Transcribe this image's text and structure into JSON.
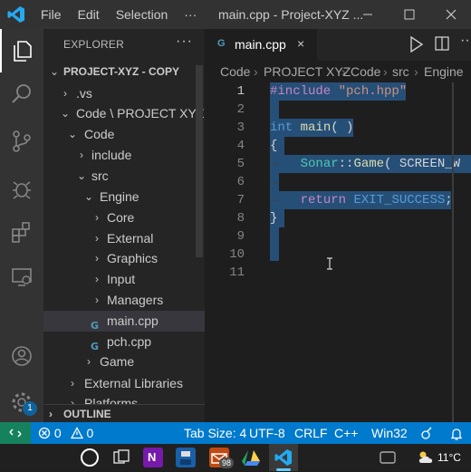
{
  "titlebar": {
    "menus": [
      "File",
      "Edit",
      "Selection",
      "···"
    ],
    "title": "main.cpp - Project-XYZ ..."
  },
  "explorer": {
    "header": "EXPLORER",
    "more": "···",
    "root": "PROJECT-XYZ - COPY",
    "items": [
      {
        "label": ".vs",
        "expanded": false
      },
      {
        "label": "Code \\ PROJECT XYZ",
        "expanded": true
      },
      {
        "label": "Code",
        "expanded": true
      },
      {
        "label": "include",
        "expanded": false
      },
      {
        "label": "src",
        "expanded": true
      },
      {
        "label": "Engine",
        "expanded": true
      },
      {
        "label": "Core",
        "expanded": false
      },
      {
        "label": "External",
        "expanded": false
      },
      {
        "label": "Graphics",
        "expanded": false
      },
      {
        "label": "Input",
        "expanded": false
      },
      {
        "label": "Managers",
        "expanded": false
      },
      {
        "label": "main.cpp",
        "file": true,
        "selected": true
      },
      {
        "label": "pch.cpp",
        "file": true
      },
      {
        "label": "Game",
        "expanded": false
      },
      {
        "label": "External Libraries",
        "expanded": false
      },
      {
        "label": "Platforms",
        "expanded": false
      }
    ],
    "outline": "OUTLINE"
  },
  "tab": {
    "icon": "C++",
    "label": "main.cpp",
    "close": "×"
  },
  "breadcrumb": [
    "Code",
    "PROJECT XYZ",
    "Code",
    "src",
    "Engine"
  ],
  "editor": {
    "line_numbers": [
      "1",
      "2",
      "3",
      "4",
      "5",
      "6",
      "7",
      "8",
      "9",
      "10",
      "11"
    ],
    "current_line": "1",
    "code": {
      "l1_pp": "#include",
      "l1_str": "\"pch.hpp\"",
      "l3_kw": "int",
      "l3_fn": "main",
      "l3_rest": "( )",
      "l4": "{",
      "l5_ns": "Sonar",
      "l5_sep": "::",
      "l5_fn": "Game",
      "l5_rest": "( SCREEN_W",
      "l7_kw": "return",
      "l7_mac": "EXIT_SUCCESS",
      "l7_end": ";",
      "l8": "}"
    }
  },
  "status": {
    "remote": "><",
    "errors": "0",
    "warnings": "0",
    "tab_size": "Tab Size: 4",
    "encoding": "UTF-8",
    "eol": "CRLF",
    "language": "C++",
    "platform": "Win32"
  },
  "taskbar": {
    "mail_badge": "98",
    "weather": "11°C"
  },
  "activity_badge": "1",
  "colors": {
    "accent": "#007acc",
    "selection": "#264f78",
    "remote": "#16825d"
  }
}
